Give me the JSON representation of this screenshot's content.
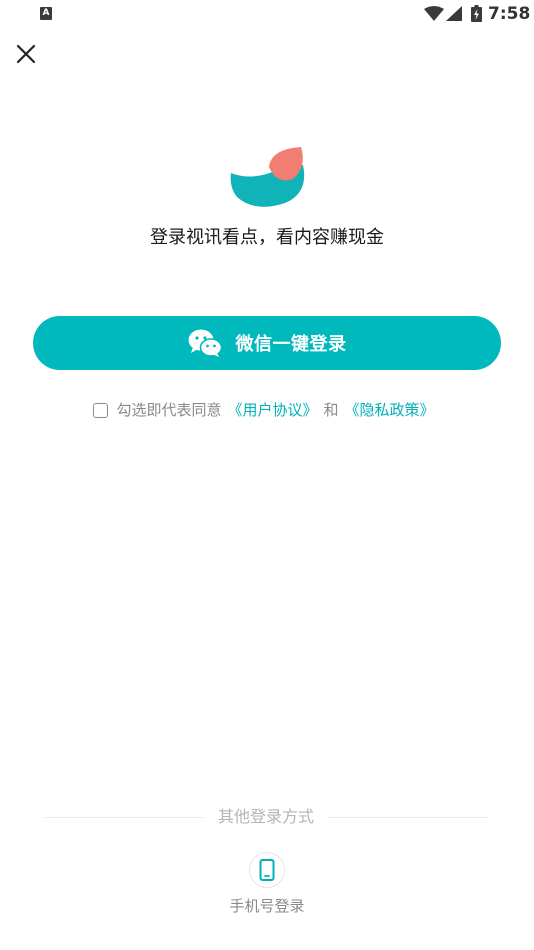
{
  "status_bar": {
    "app_indicator": "A",
    "time": "7:58"
  },
  "icons": {
    "close": "close-icon",
    "wechat": "wechat-icon",
    "phone": "phone-icon",
    "logo": "app-logo"
  },
  "colors": {
    "accent": "#00b9bc",
    "link": "#00b2b8",
    "logo_teal": "#10b3b8",
    "logo_coral": "#f27d73"
  },
  "main": {
    "tagline": "登录视讯看点，看内容赚现金",
    "wechat_button_label": "微信一键登录"
  },
  "agreement": {
    "checked": false,
    "prefix": "勾选即代表同意",
    "user_agreement": "《用户协议》",
    "and": "和",
    "privacy_policy": "《隐私政策》"
  },
  "other_login": {
    "label": "其他登录方式",
    "phone_label": "手机号登录"
  }
}
